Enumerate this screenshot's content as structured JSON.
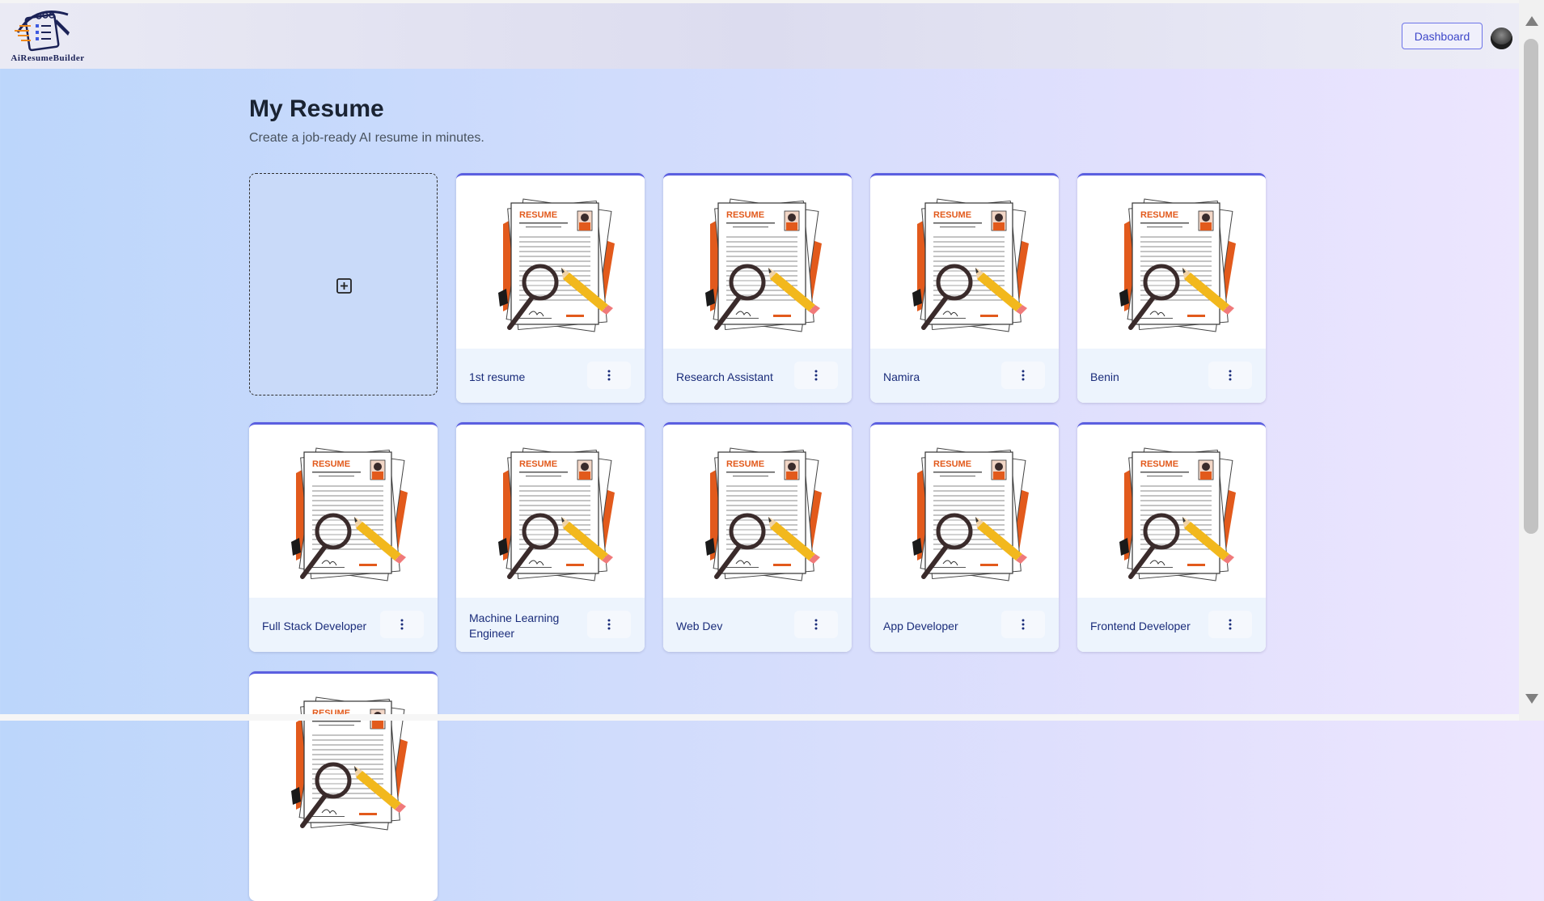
{
  "brand": {
    "name": "AiResumeBuilder"
  },
  "header": {
    "dashboard_label": "Dashboard",
    "avatar_icon": "user-avatar"
  },
  "page": {
    "title": "My Resume",
    "subtitle": "Create a job-ready AI resume in minutes."
  },
  "add_card": {
    "icon": "plus-square-icon"
  },
  "resumes": [
    {
      "title": "1st resume"
    },
    {
      "title": "Research Assistant"
    },
    {
      "title": "Namira"
    },
    {
      "title": "Benin"
    },
    {
      "title": "Full Stack Developer"
    },
    {
      "title": "Machine Learning Engineer"
    },
    {
      "title": "Web Dev"
    },
    {
      "title": "App Developer"
    },
    {
      "title": "Frontend Developer"
    },
    {
      "title": ""
    }
  ],
  "thumbnail_text": {
    "heading": "RESUME"
  },
  "colors": {
    "accent": "#5b5fe0",
    "card_title": "#1a2c7a",
    "resume_orange": "#e25a1c"
  }
}
